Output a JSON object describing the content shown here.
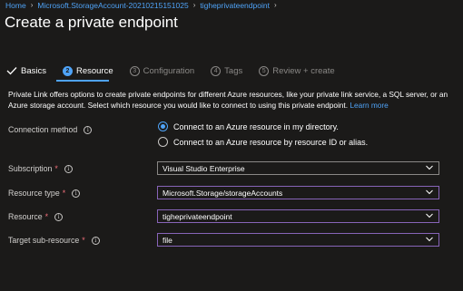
{
  "breadcrumb": {
    "items": [
      "Home",
      "Microsoft.StorageAccount-20210215151025",
      "tigheprivateendpoint"
    ]
  },
  "page_title": "Create a private endpoint",
  "tabs": [
    {
      "label": "Basics",
      "state": "done",
      "step": ""
    },
    {
      "label": "Resource",
      "state": "active",
      "step": "2"
    },
    {
      "label": "Configuration",
      "state": "pending",
      "step": "3"
    },
    {
      "label": "Tags",
      "state": "pending",
      "step": "4"
    },
    {
      "label": "Review + create",
      "state": "pending",
      "step": "5"
    }
  ],
  "description": {
    "text": "Private Link offers options to create private endpoints for different Azure resources, like your private link service, a SQL server, or an Azure storage account. Select which resource you would like to connect to using this private endpoint.",
    "link": "Learn more"
  },
  "connection_method": {
    "label": "Connection method",
    "options": [
      {
        "label": "Connect to an Azure resource in my directory.",
        "checked": true
      },
      {
        "label": "Connect to an Azure resource by resource ID or alias.",
        "checked": false
      }
    ]
  },
  "fields": {
    "subscription": {
      "label": "Subscription",
      "required": "*",
      "value": "Visual Studio Enterprise"
    },
    "resource_type": {
      "label": "Resource type",
      "required": "*",
      "value": "Microsoft.Storage/storageAccounts"
    },
    "resource": {
      "label": "Resource",
      "required": "*",
      "value": "tigheprivateendpoint"
    },
    "target_sub_resource": {
      "label": "Target sub-resource",
      "required": "*",
      "value": "file"
    }
  },
  "icons": {
    "info": "info-icon",
    "chevron": "chevron-down-icon",
    "check": "check-icon"
  },
  "colors": {
    "background": "#1b1a19",
    "accent": "#4fa3f7",
    "focus_border": "#8764b8",
    "required": "#f1707b"
  }
}
